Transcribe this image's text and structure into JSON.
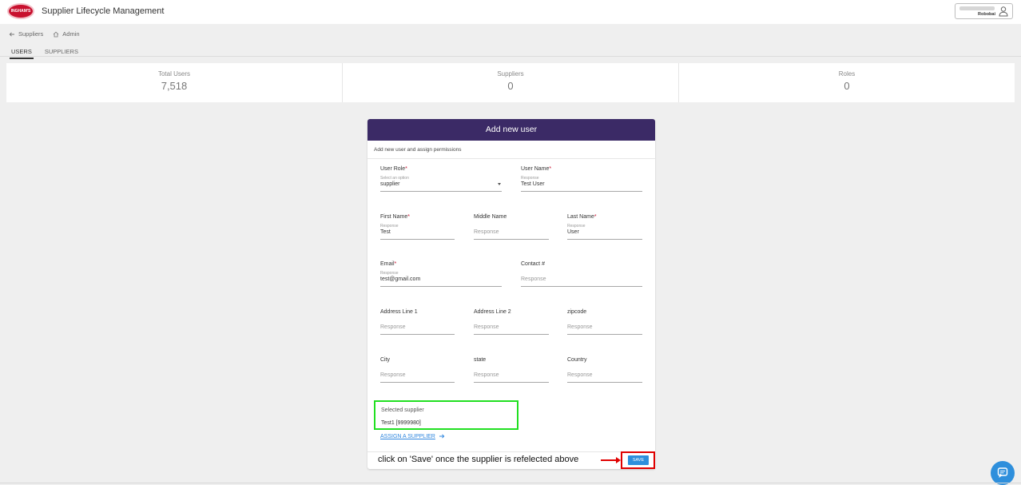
{
  "header": {
    "logo_text": "INGHAM'S",
    "app_title": "Supplier Lifecycle Management",
    "user_company": "Robobai"
  },
  "breadcrumb": {
    "back": "Suppliers",
    "home": "Admin"
  },
  "tabs": [
    {
      "label": "USERS",
      "active": true
    },
    {
      "label": "SUPPLIERS",
      "active": false
    }
  ],
  "stats": [
    {
      "label": "Total Users",
      "value": "7,518"
    },
    {
      "label": "Suppliers",
      "value": "0"
    },
    {
      "label": "Roles",
      "value": "0"
    }
  ],
  "form": {
    "title": "Add new user",
    "subtitle": "Add new user and assign permissions",
    "user_role": {
      "label": "User Role",
      "hint": "Select an option",
      "value": "supplier"
    },
    "user_name": {
      "label": "User Name",
      "hint": "Response",
      "value": "Test User"
    },
    "first_name": {
      "label": "First Name",
      "hint": "Response",
      "value": "Test"
    },
    "middle_name": {
      "label": "Middle Name",
      "placeholder": "Response"
    },
    "last_name": {
      "label": "Last Name",
      "hint": "Response",
      "value": "User"
    },
    "email": {
      "label": "Email",
      "hint": "Response",
      "value": "test@gmail.com"
    },
    "contact": {
      "label": "Contact #",
      "placeholder": "Response"
    },
    "address1": {
      "label": "Address Line 1",
      "placeholder": "Response"
    },
    "address2": {
      "label": "Address Line 2",
      "placeholder": "Response"
    },
    "zipcode": {
      "label": "zipcode",
      "placeholder": "Response"
    },
    "city": {
      "label": "City",
      "placeholder": "Response"
    },
    "state": {
      "label": "state",
      "placeholder": "Response"
    },
    "country": {
      "label": "Country",
      "placeholder": "Response"
    },
    "required_mark": "*",
    "selected_supplier": {
      "label": "Selected supplier",
      "value": "Test1 [9999980]"
    },
    "assign_link": "ASSIGN A SUPPLIER",
    "save_label": "SAVE"
  },
  "annotation": "click on 'Save' once the supplier is refelected above",
  "colors": {
    "header_purple": "#3b2a66",
    "accent_blue": "#2e8fdc",
    "highlight_green": "#21e021",
    "highlight_red": "#e00000",
    "brand_red": "#c8102e"
  },
  "icons": [
    "back-arrow-icon",
    "home-icon",
    "user-icon",
    "dropdown-caret-icon",
    "arrow-right-icon",
    "chat-icon"
  ]
}
